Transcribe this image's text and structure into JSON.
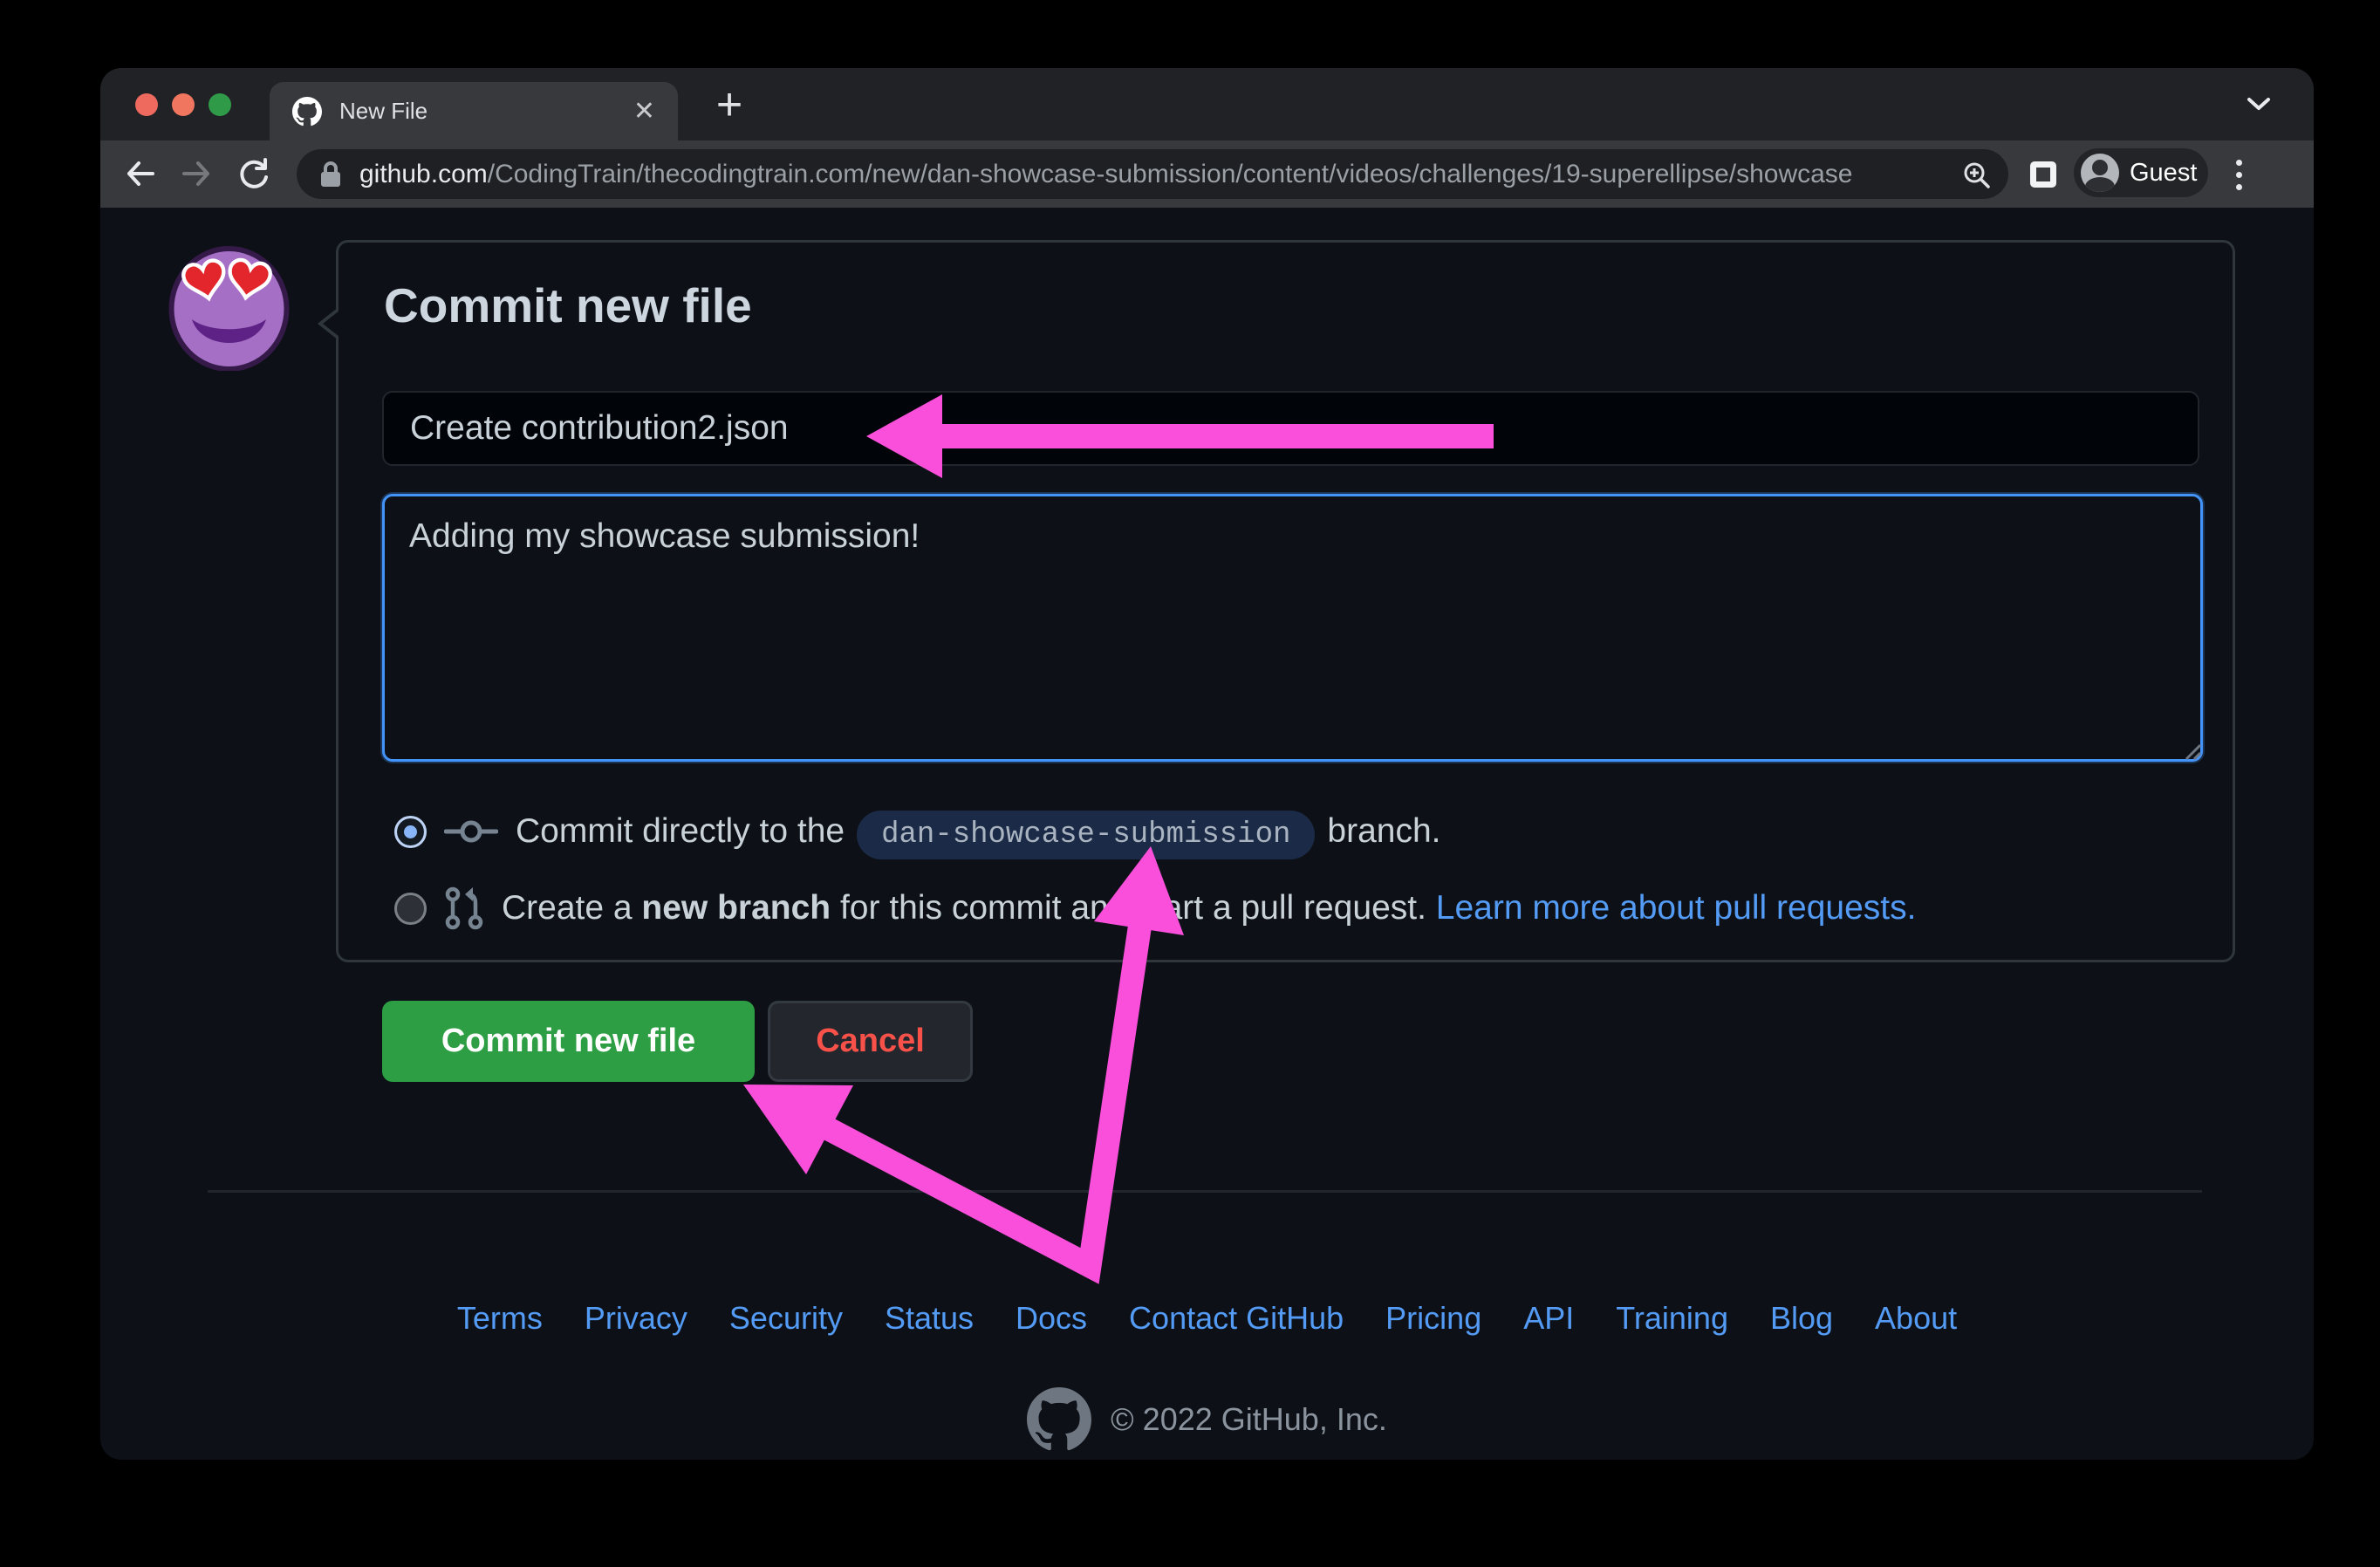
{
  "window": {
    "tab": {
      "title": "New File"
    },
    "toolbar": {
      "url_domain": "github.com",
      "url_path": "/CodingTrain/thecodingtrain.com/new/dan-showcase-submission/content/videos/challenges/19-superellipse/showcase",
      "guest_label": "Guest"
    }
  },
  "page": {
    "heading": "Commit new file",
    "commit_title_value": "Create contribution2.json",
    "commit_description_value": "Adding my showcase submission!",
    "radio_direct": {
      "text_before": "Commit directly to the",
      "branch_name": "dan-showcase-submission",
      "text_after": "branch."
    },
    "radio_branch": {
      "text_1": "Create a ",
      "text_bold": "new branch",
      "text_2": " for this commit and start a pull request. ",
      "link": "Learn more about pull requests."
    },
    "buttons": {
      "commit": "Commit new file",
      "cancel": "Cancel"
    },
    "footer": {
      "links": [
        "Terms",
        "Privacy",
        "Security",
        "Status",
        "Docs",
        "Contact GitHub",
        "Pricing",
        "API",
        "Training",
        "Blog",
        "About"
      ],
      "copyright": "© 2022 GitHub, Inc."
    }
  },
  "colors": {
    "arrow": "#fa4fdb",
    "accent_green": "#2e9e44",
    "link_blue": "#539bf5",
    "danger_red": "#f85149",
    "focus_blue": "#4493f8",
    "page_bg": "#0d1117"
  }
}
